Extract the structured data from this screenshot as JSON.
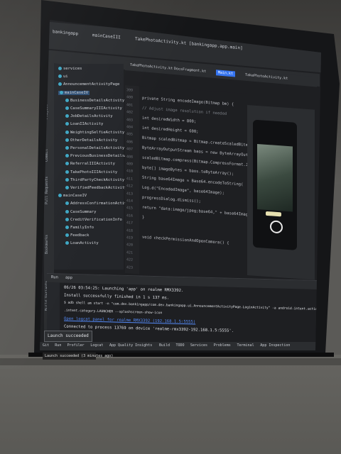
{
  "ide": {
    "titlebar": [
      "bankingapp",
      "mainCaseIII",
      "TakePhotoActivity.kt [bankingapp.app.main]"
    ],
    "tabs": [
      "TakePhotoActivity.kt",
      "DocsFragment.kt",
      "Main.kt",
      "TakePhotoActivity.kt"
    ],
    "left_tools": [
      "Project",
      "Commit",
      "Pull Requests",
      "Bookmarks",
      "Build Variants"
    ]
  },
  "project_tree": {
    "items": [
      "services",
      "ui",
      "AnnouncementActivityPage",
      "mainCaseIV",
      "BusinessDetailsActivity",
      "CaseSummaryIIIActivity",
      "JobDetailsActivity",
      "LoanIIActivity",
      "WeightingSelfieActivity",
      "OtherDetailsActivity",
      "PersonalDetailsActivity",
      "PreviousBusinessDetailsActivity",
      "ReferralIIIActivity",
      "TakePhotoIIIActivity",
      "ThirdPartyCheckActivity",
      "VerifiedFeedbackActivity",
      "mainCaseIV",
      "AddressConfirmationActivity",
      "CaseSummary",
      "CreditVerificationInfo",
      "FamilyInfo",
      "Feedback",
      "LoanActivity"
    ]
  },
  "editor": {
    "line_numbers": [
      "399",
      "400",
      "401",
      "402",
      "403",
      "404",
      "405",
      "406",
      "407",
      "408",
      "409",
      "410",
      "411",
      "412",
      "413",
      "414",
      "415",
      "416",
      "417",
      "418",
      "419",
      "420",
      "421",
      "422",
      "423"
    ],
    "lines": [
      "private String encodeImage(Bitmap bm) {",
      "  // Adjust image resolution if needed",
      "  int desiredWidth = 800;",
      "  int desiredHeight = 600;",
      "  Bitmap scaledBitmap = Bitmap.createScaledBitmap(",
      "  ByteArrayOutputStream baos = new ByteArrayOutputStream();",
      "  scaledBitmap.compress(Bitmap.CompressFormat.JPEG, 80, baos);",
      "  byte[] imageBytes = baos.toByteArray();",
      "  String base64Image = Base64.encodeToString(",
      "  Log.d(\"EncodedImage\", base64Image);",
      "  progressDialog.dismiss();",
      "  return \"data:image/jpeg;base64,\" + base64Image;",
      "}",
      "",
      "void checkPermissionAndOpenCamera() {"
    ]
  },
  "run_panel": {
    "header": [
      "Run",
      "app"
    ],
    "log": [
      "06/26 03:54:25: Launching 'app' on realme RMX3392.",
      "Install successfully finished in 1 s 137 ms.",
      "$ adb shell am start -n \"com.dev.bankingapp/com.dev.bankingapp.ui.AnnouncementActivityPage.LoginActivity\" -a android.intent.action.MAIN -c android",
      "  .intent.category.LAUNCHER --splashscreen-show-icon",
      "Open logcat panel for realme RMX3392 (192.168.1.5:5555)",
      "Connected to process 13769 on device 'realme-rmx3392-192.168.1.5:5555'."
    ],
    "toast": "Launch succeeded"
  },
  "statusbar": {
    "items": [
      "Git",
      "Run",
      "Profiler",
      "Logcat",
      "App Quality Insights",
      "Build",
      "TODO",
      "Services",
      "Problems",
      "Terminal",
      "App Inspection"
    ],
    "launch": "Launch succeeded (3 minutes ago)"
  },
  "colors": {
    "accent": "#3574f0",
    "bg": "#1e1f22",
    "panel": "#2b2d30",
    "link": "#548af7"
  }
}
